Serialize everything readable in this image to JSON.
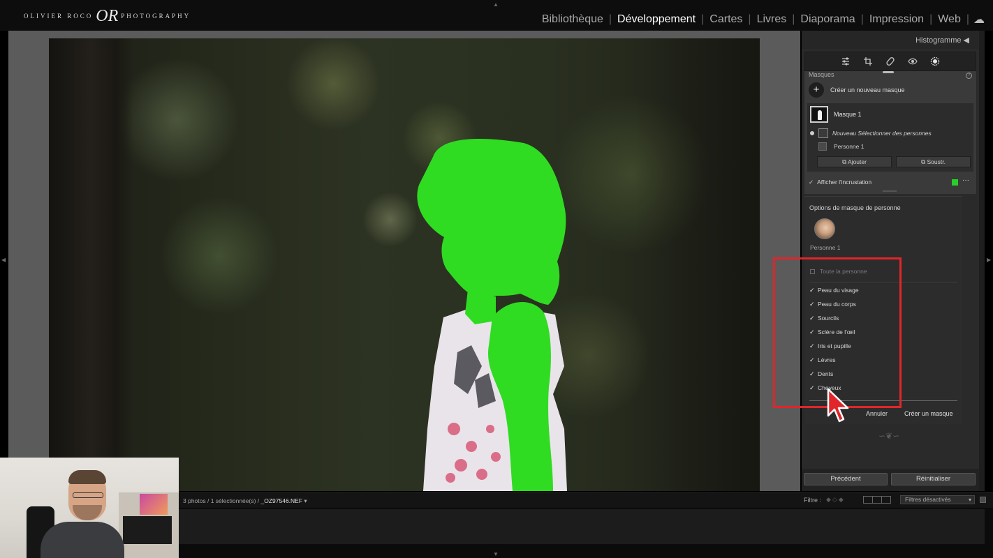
{
  "app": {
    "logo_left": "OLIVIER ROCO",
    "logo_mark": "OR",
    "logo_right": "PHOTOGRAPHY"
  },
  "modules": [
    {
      "label": "Bibliothèque",
      "active": false
    },
    {
      "label": "Développement",
      "active": true
    },
    {
      "label": "Cartes",
      "active": false
    },
    {
      "label": "Livres",
      "active": false
    },
    {
      "label": "Diaporama",
      "active": false
    },
    {
      "label": "Impression",
      "active": false
    },
    {
      "label": "Web",
      "active": false
    }
  ],
  "panel": {
    "histogram_label": "Histogramme",
    "tools": [
      "edit-sliders-icon",
      "crop-icon",
      "healing-icon",
      "red-eye-icon",
      "masking-icon"
    ],
    "masks": {
      "title": "Masques",
      "create_new": "Créer un nouveau masque",
      "mask_name": "Masque 1",
      "submask_name": "Nouveau Sélectionner des personnes",
      "person_name": "Personne 1",
      "add_label": "Ajouter",
      "subtract_label": "Soustr.",
      "overlay_label": "Afficher l'incrustation",
      "overlay_checked": true,
      "overlay_color": "#28d028"
    },
    "person_options": {
      "title": "Options de masque de personne",
      "person_caption": "Personne 1",
      "whole_person": {
        "label": "Toute la personne",
        "checked": false
      },
      "parts": [
        {
          "label": "Peau du visage",
          "checked": true
        },
        {
          "label": "Peau du corps",
          "checked": true
        },
        {
          "label": "Sourcils",
          "checked": true
        },
        {
          "label": "Sclère de l'œil",
          "checked": true
        },
        {
          "label": "Iris et pupille",
          "checked": true
        },
        {
          "label": "Lèvres",
          "checked": true
        },
        {
          "label": "Dents",
          "checked": true
        },
        {
          "label": "Cheveux",
          "checked": true
        }
      ],
      "cancel_label": "Annuler",
      "create_label": "Créer un masque"
    },
    "previous_label": "Précédent",
    "reset_label": "Réinitialiser"
  },
  "filmstrip": {
    "info_prefix": "3 photos / 1 sélectionnée(s) / ",
    "filename": "_OZ97546.NEF",
    "filter_label": "Filtre :",
    "filter_value": "Filtres désactivés"
  },
  "colors": {
    "highlight": "#e0262b",
    "mask_overlay": "#28d028"
  }
}
